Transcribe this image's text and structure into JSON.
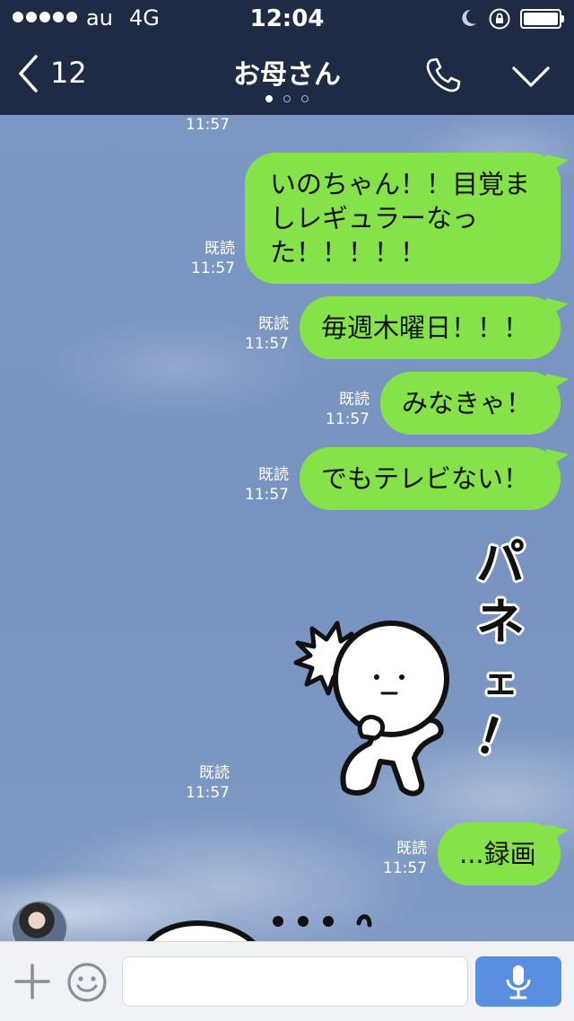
{
  "status_bar": {
    "carrier": "au",
    "network": "4G",
    "time": "12:04"
  },
  "header": {
    "back_count": "12",
    "title": "お母さん",
    "page_count": 3,
    "active_page": 0
  },
  "chat": {
    "top_partial_time": "11:57",
    "messages": [
      {
        "lines": [
          "いのちゃん！！目覚ま",
          "しレギュラーなっ",
          "た！！！！！"
        ],
        "read_label": "既読",
        "time": "11:57"
      },
      {
        "lines": [
          "毎週木曜日！！！"
        ],
        "read_label": "既読",
        "time": "11:57"
      },
      {
        "lines": [
          "みなきゃ！"
        ],
        "read_label": "既読",
        "time": "11:57"
      },
      {
        "lines": [
          "でもテレビない！"
        ],
        "read_label": "既読",
        "time": "11:57"
      }
    ],
    "sticker": {
      "read_label": "既読",
      "time": "11:57",
      "text_chars": [
        "パ",
        "ネ",
        "ェ",
        "！"
      ]
    },
    "last_message": {
      "lines": [
        "...録画"
      ],
      "read_label": "既読",
      "time": "11:57"
    }
  },
  "input_bar": {
    "placeholder": ""
  },
  "colors": {
    "header_bg": "#1f2b44",
    "bubble_green": "#85e249",
    "chat_bg": "#7c97c4",
    "mic_blue": "#5a8ee0"
  },
  "icons": [
    "back-chevron-icon",
    "phone-icon",
    "chevron-down-icon",
    "moon-icon",
    "rotation-lock-icon",
    "battery-icon",
    "plus-icon",
    "emoji-icon",
    "microphone-icon"
  ]
}
